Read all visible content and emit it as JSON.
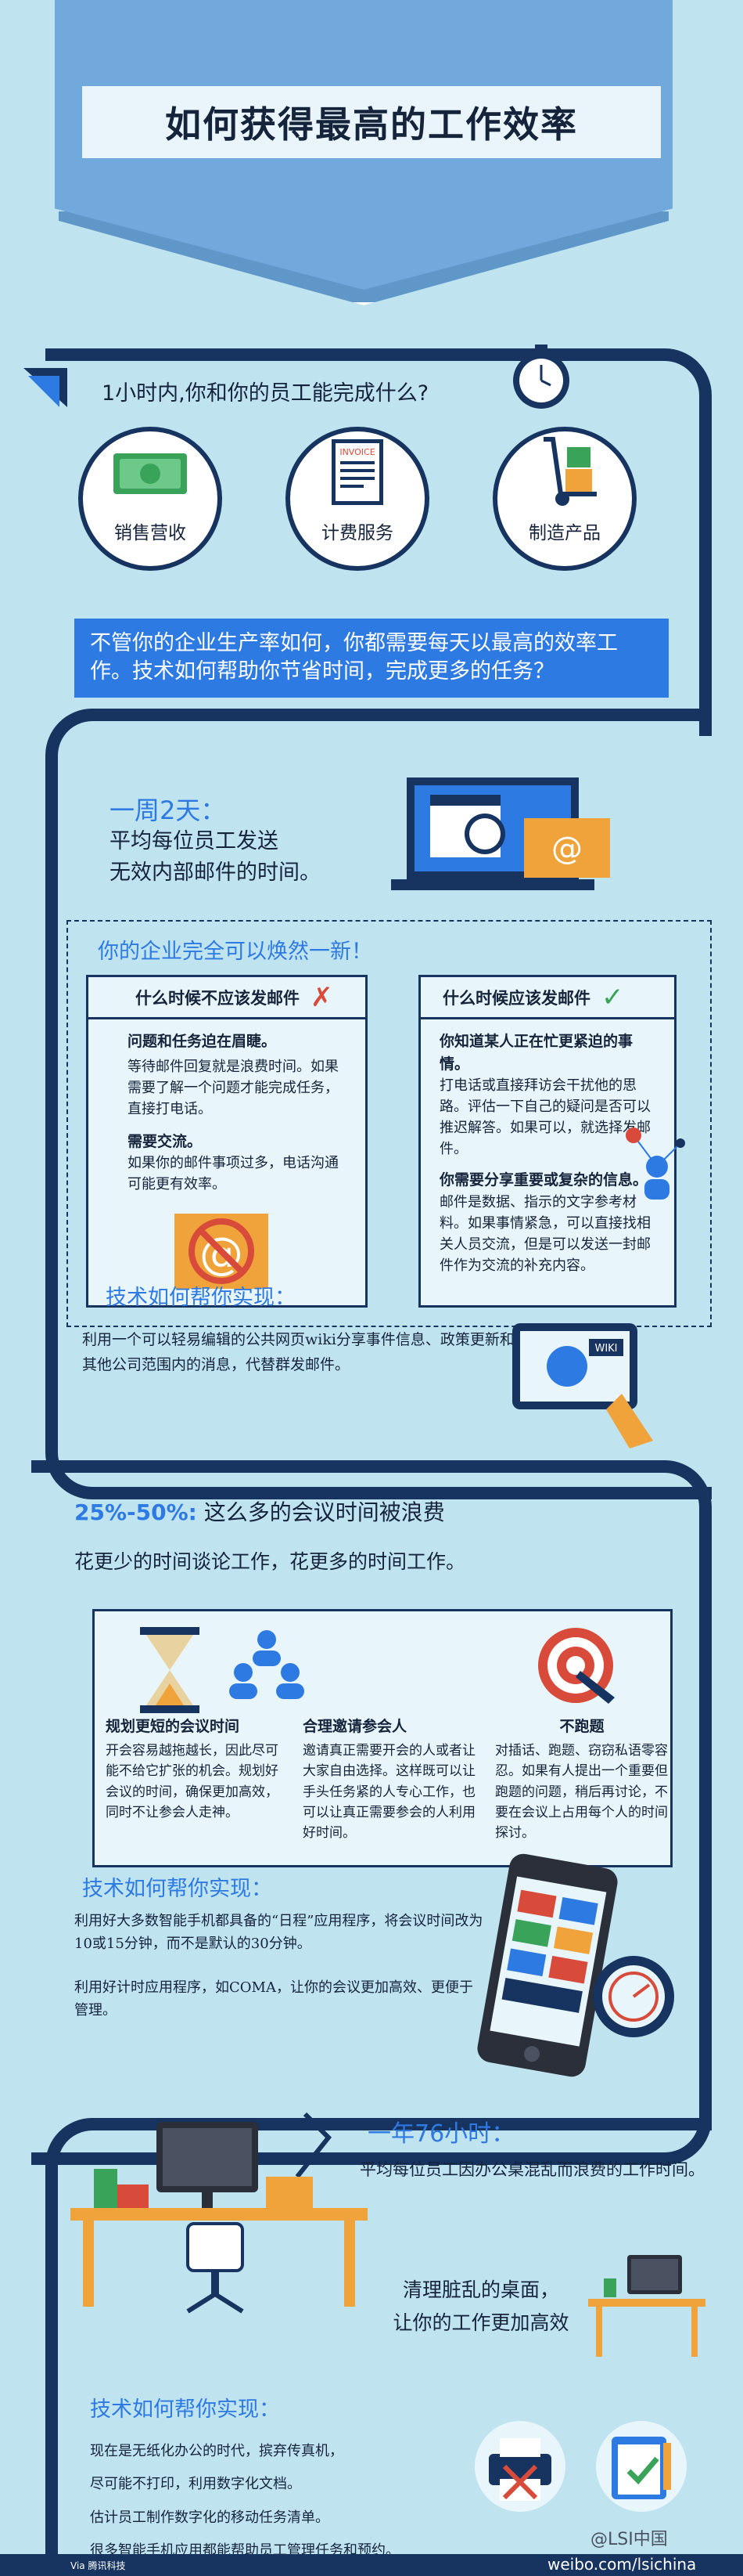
{
  "title": "如何获得最高的工作效率",
  "section1": {
    "question": "1小时内,你和你的员工能完成什么?",
    "items": [
      {
        "label": "销售营收",
        "icon": "money-icon"
      },
      {
        "label": "计费服务",
        "icon": "invoice-icon",
        "icon_text": "INVOICE"
      },
      {
        "label": "制造产品",
        "icon": "hand-truck-icon"
      }
    ],
    "summary": "不管你的企业生产率如何，你都需要每天以最高的效率工作。技术如何帮助你节省时间，完成更多的任务？"
  },
  "section2": {
    "heading": "一周2天：",
    "line1": "平均每位员工发送",
    "line2": "无效内部邮件的时间。",
    "subheading": "你的企业完全可以焕然一新！",
    "when_not": {
      "title": "什么时候不应该发邮件",
      "p1_title": "问题和任务迫在眉睫。",
      "p1": "等待邮件回复就是浪费时间。如果需要了解一个问题才能完成任务，直接打电话。",
      "p2_title": "需要交流。",
      "p2": "如果你的邮件事项过多，电话沟通可能更有效率。"
    },
    "when_yes": {
      "title": "什么时候应该发邮件",
      "p1_title": "你知道某人正在忙更紧迫的事情。",
      "p1": "打电话或直接拜访会干扰他的思路。评估一下自己的疑问是否可以推迟解答。如果可以，就选择发邮件。",
      "p2_title": "你需要分享重要或复杂的信息。",
      "p2": "邮件是数据、指示的文字参考材料。如果事情紧急，可以直接找相关人员交流，但是可以发送一封邮件作为交流的补充内容。"
    },
    "tech_heading": "技术如何帮你实现：",
    "tech_text": "利用一个可以轻易编辑的公共网页wiki分享事件信息、政策更新和其他公司范围内的消息，代替群发邮件。",
    "wiki_label": "WIKI"
  },
  "section3": {
    "percent": "25%-50%:",
    "heading_rest": " 这么多的会议时间被浪费",
    "sub": "花更少的时间谈论工作，花更多的时间工作。",
    "cols": [
      {
        "title": "规划更短的会议时间",
        "text": "开会容易越拖越长，因此尽可能不给它扩张的机会。规划好会议的时间，确保更加高效，同时不让参会人走神。"
      },
      {
        "title": "合理邀请参会人",
        "text": "邀请真正需要开会的人或者让大家自由选择。这样既可以让手头任务紧的人专心工作，也可以让真正需要参会的人利用好时间。"
      },
      {
        "title": "不跑题",
        "text": "对插话、跑题、窃窃私语零容忍。如果有人提出一个重要但跑题的问题，稍后再讨论，不要在会议上占用每个人的时间探讨。"
      }
    ],
    "tech_heading": "技术如何帮你实现：",
    "tech_p1": "利用好大多数智能手机都具备的“日程”应用程序，将会议时间改为10或15分钟，而不是默认的30分钟。",
    "tech_p2": "利用好计时应用程序，如COMA，让你的会议更加高效、更便于管理。"
  },
  "section4": {
    "heading": "一年76小时：",
    "line": "平均每位员工因办公桌混乱而浪费的工作时间。",
    "clean1": "清理脏乱的桌面，",
    "clean2": "让你的工作更加高效",
    "tech_heading": "技术如何帮你实现：",
    "lines": [
      "现在是无纸化办公的时代，摈弃传真机，",
      "尽可能不打印，利用数字化文档。",
      "估计员工制作数字化的移动任务清单。",
      "很多智能手机应用都能帮助员工管理任务和预约。"
    ],
    "source": "Via 腾讯科技",
    "watermark_handle": "@LSI中国",
    "watermark_url": "weibo.com/lsichina"
  },
  "colors": {
    "background": "#bfe3ef",
    "navy": "#16345f",
    "accent_blue": "#2e7ae3",
    "banner": "#71a9dc",
    "red": "#d84a3a",
    "green": "#3aa35a",
    "orange": "#f0a33a"
  }
}
